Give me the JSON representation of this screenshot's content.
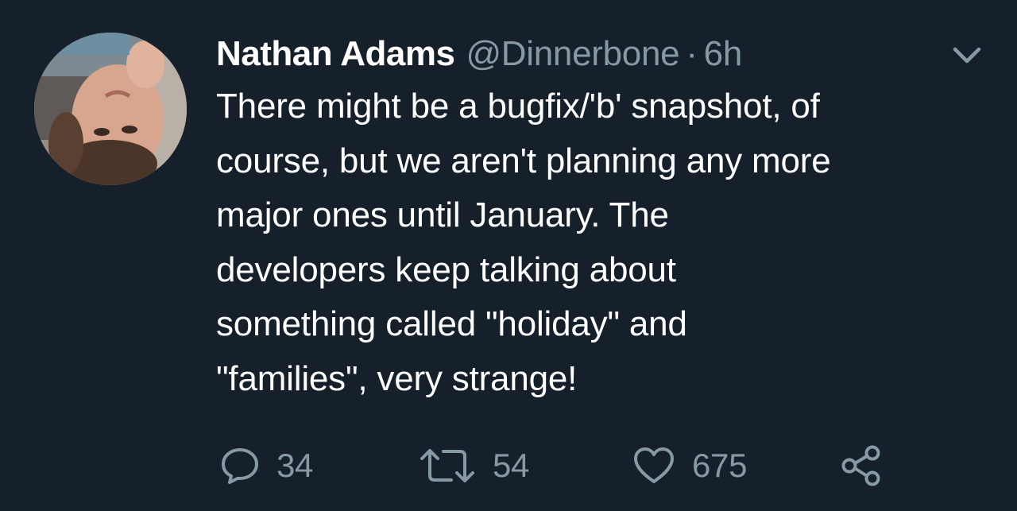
{
  "tweet": {
    "author": {
      "display_name": "Nathan Adams",
      "handle": "@Dinnerbone",
      "avatar_icon": "profile-photo"
    },
    "separator": "·",
    "timestamp": "6h",
    "menu_icon": "chevron-down-icon",
    "text": "There might be a bugfix/'b' snapshot, of\ncourse, but we aren't planning any more\nmajor ones until January. The\ndevelopers keep talking about\nsomething called \"holiday\" and\n\"families\", very strange!",
    "actions": {
      "reply": {
        "icon": "comment-icon",
        "count": "34"
      },
      "retweet": {
        "icon": "retweet-icon",
        "count": "54"
      },
      "like": {
        "icon": "heart-icon",
        "count": "675"
      },
      "share": {
        "icon": "share-icon"
      }
    }
  },
  "colors": {
    "background": "#15202b",
    "primary_text": "#ffffff",
    "secondary_text": "#8899a6"
  }
}
